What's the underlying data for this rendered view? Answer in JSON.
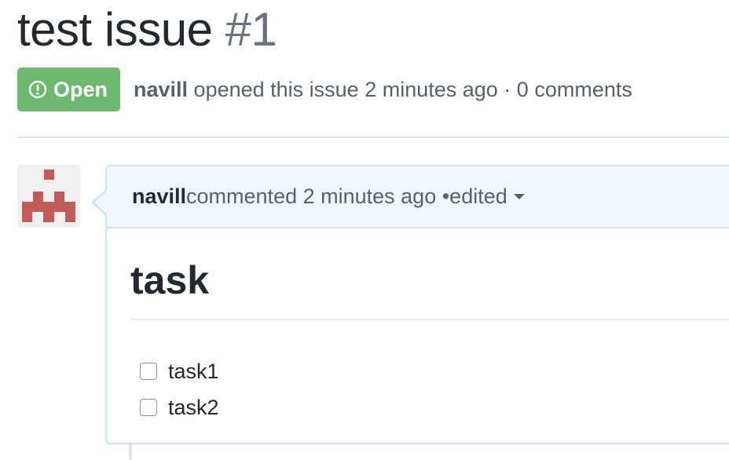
{
  "issue": {
    "title": "test issue",
    "number": "#1",
    "state_label": "Open",
    "meta": {
      "author": "navill",
      "text": " opened this issue 2 minutes ago · 0 comments"
    }
  },
  "comment": {
    "author": "navill",
    "action": " commented 2 minutes ago • ",
    "edited_label": "edited",
    "body": {
      "heading": "task",
      "tasks": [
        {
          "label": "task1",
          "checked": false
        },
        {
          "label": "task2",
          "checked": false
        }
      ]
    }
  },
  "colors": {
    "open_badge": "#6cb96f",
    "comment_border": "#c8e1ff",
    "comment_header_bg": "#f1f8ff",
    "avatar_identicon": "#c25b58"
  },
  "icons": {
    "state": "issue-opened-icon",
    "avatar": "identicon",
    "edited": "caret-down-icon"
  }
}
